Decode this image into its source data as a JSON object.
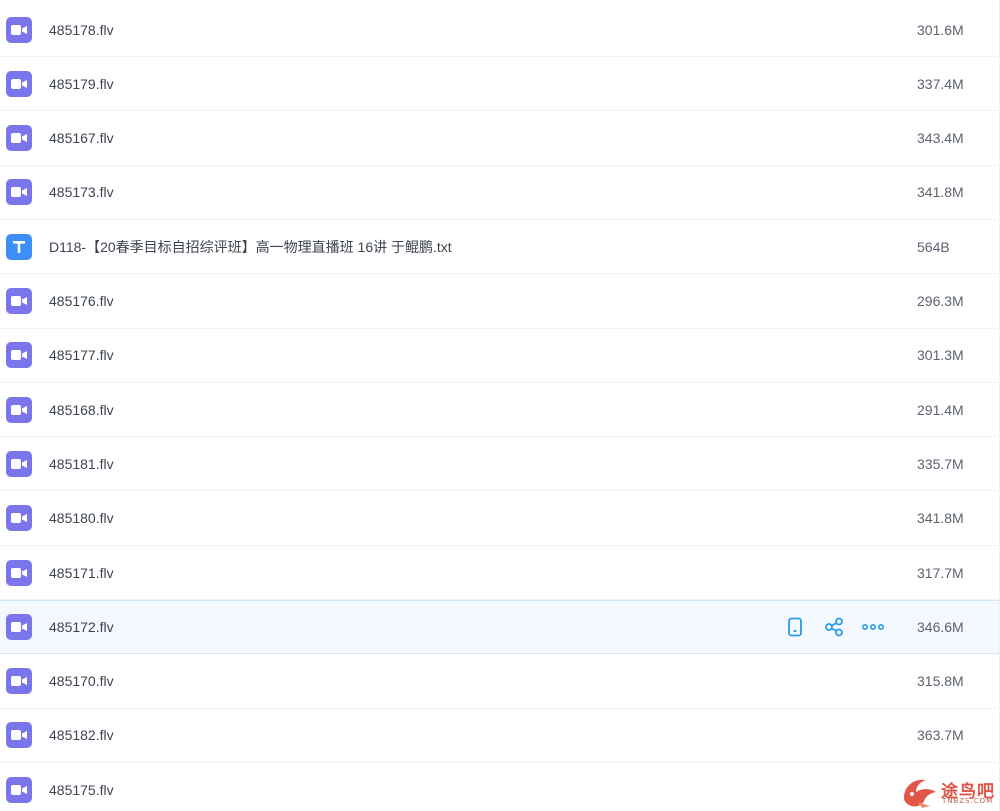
{
  "files": [
    {
      "name": "485178.flv",
      "size": "301.6M",
      "type": "video"
    },
    {
      "name": "485179.flv",
      "size": "337.4M",
      "type": "video"
    },
    {
      "name": "485167.flv",
      "size": "343.4M",
      "type": "video"
    },
    {
      "name": "485173.flv",
      "size": "341.8M",
      "type": "video"
    },
    {
      "name": "D118-【20春季目标自招综评班】高一物理直播班 16讲 于鲲鹏.txt",
      "size": "564B",
      "type": "text"
    },
    {
      "name": "485176.flv",
      "size": "296.3M",
      "type": "video"
    },
    {
      "name": "485177.flv",
      "size": "301.3M",
      "type": "video"
    },
    {
      "name": "485168.flv",
      "size": "291.4M",
      "type": "video"
    },
    {
      "name": "485181.flv",
      "size": "335.7M",
      "type": "video"
    },
    {
      "name": "485180.flv",
      "size": "341.8M",
      "type": "video"
    },
    {
      "name": "485171.flv",
      "size": "317.7M",
      "type": "video"
    },
    {
      "name": "485172.flv",
      "size": "346.6M",
      "type": "video",
      "hovered": true
    },
    {
      "name": "485170.flv",
      "size": "315.8M",
      "type": "video"
    },
    {
      "name": "485182.flv",
      "size": "363.7M",
      "type": "video"
    },
    {
      "name": "485175.flv",
      "size": "",
      "type": "video"
    }
  ],
  "row_actions": [
    "phone-icon",
    "share-icon",
    "more-icon"
  ],
  "watermark": {
    "text": "途鸟吧",
    "sub": "TNBZS.COM"
  },
  "colors": {
    "video_icon": "#7b75ec",
    "text_icon": "#3e8ef7",
    "action_icon": "#2a9be8",
    "hover_row": "#f4f9ff",
    "watermark": "#e0574a"
  }
}
